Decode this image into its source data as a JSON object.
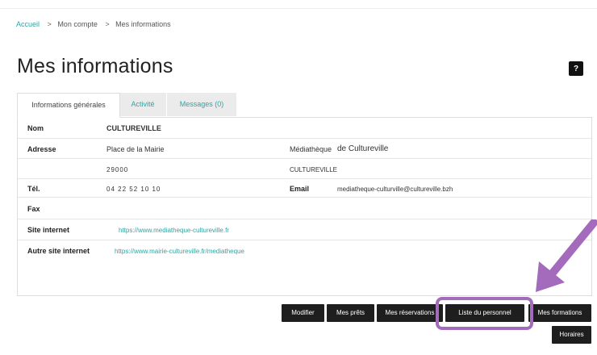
{
  "breadcrumb": {
    "home": "Accueil",
    "separator": ">",
    "items": [
      "Mon compte",
      "Mes informations"
    ]
  },
  "page": {
    "title": "Mes informations",
    "help_glyph": "?"
  },
  "tabs": [
    {
      "label": "Informations générales",
      "active": true
    },
    {
      "label": "Activité",
      "active": false
    },
    {
      "label": "Messages (0)",
      "active": false
    }
  ],
  "info": {
    "nom_label": "Nom",
    "nom_value": "CULTUREVILLE",
    "adresse_label": "Adresse",
    "adresse_value": "Place de la Mairie",
    "mediatheque_prefix": "Médiathèque",
    "mediatheque_name": "de Cultureville",
    "postal_code": "29000",
    "city": "CULTUREVILLE",
    "tel_label": "Tél.",
    "tel_value": "04 22 52 10 10",
    "email_label": "Email",
    "email_value": "mediatheque-culturville@cultureville.bzh",
    "fax_label": "Fax",
    "site_label": "Site internet",
    "site_value": "https://www.mediatheque-cultureville.fr",
    "autre_site_label": "Autre site internet",
    "autre_site_value": "https://www.mairie-cultureville.fr/mediatheque"
  },
  "actions": {
    "modifier": "Modifier",
    "mes_prets": "Mes prêts",
    "mes_reservations": "Mes réservations",
    "liste_personnel": "Liste du personnel",
    "mes_formations": "Mes formations",
    "horaires": "Horaires"
  },
  "colors": {
    "accent": "#2ca6a4",
    "highlight": "#a46bbd",
    "button_bg": "#1e1e1e"
  }
}
